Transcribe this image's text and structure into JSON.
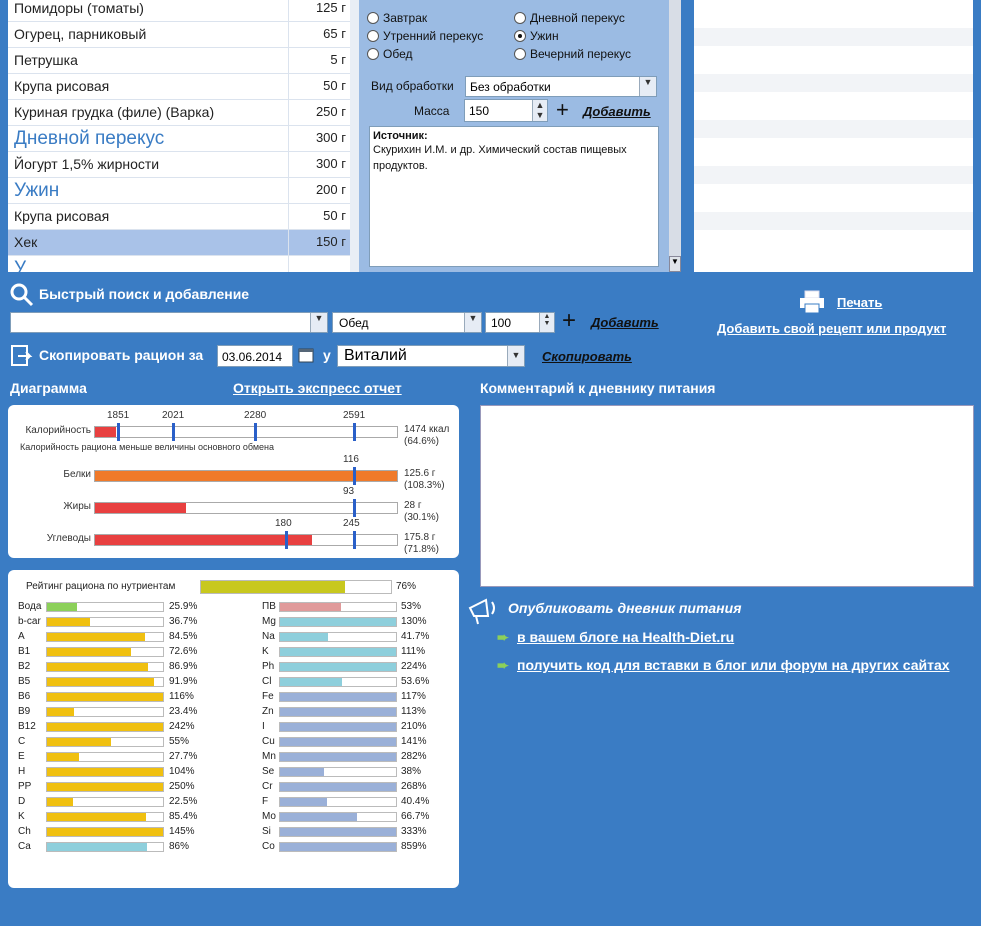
{
  "food_list": [
    {
      "name": "Помидоры (томаты)",
      "weight": "125 г",
      "type": "item"
    },
    {
      "name": "Огурец, парниковый",
      "weight": "65 г",
      "type": "item"
    },
    {
      "name": "Петрушка",
      "weight": "5 г",
      "type": "item"
    },
    {
      "name": "Крупа рисовая",
      "weight": "50 г",
      "type": "item"
    },
    {
      "name": "Куриная грудка (филе) (Варка)",
      "weight": "250 г",
      "type": "item"
    },
    {
      "name": "Дневной перекус",
      "weight": "300 г",
      "type": "header"
    },
    {
      "name": "Йогурт 1,5% жирности",
      "weight": "300 г",
      "type": "item"
    },
    {
      "name": "Ужин",
      "weight": "200 г",
      "type": "header"
    },
    {
      "name": "Крупа рисовая",
      "weight": "50 г",
      "type": "item"
    },
    {
      "name": "Хек",
      "weight": "150 г",
      "type": "selected"
    },
    {
      "name": "У",
      "weight": "",
      "type": "header"
    }
  ],
  "meal_options": {
    "breakfast": "Завтрак",
    "day_snack": "Дневной перекус",
    "morning_snack": "Утренний перекус",
    "dinner": "Ужин",
    "lunch": "Обед",
    "evening_snack": "Вечерний перекус",
    "selected": "Ужин"
  },
  "processing": {
    "label": "Вид обработки",
    "value": "Без обработки"
  },
  "mass": {
    "label": "Масса",
    "value": "150"
  },
  "add_label": "Добавить",
  "source": {
    "title": "Источник:",
    "text": "Скурихин И.М. и др. Химический состав пищевых продуктов."
  },
  "quick_search": {
    "title": "Быстрый поиск и добавление",
    "meal": "Обед",
    "amount": "100",
    "add": "Добавить",
    "input_value": ""
  },
  "print_label": "Печать",
  "add_recipe": "Добавить свой рецепт или продукт",
  "copy": {
    "title": "Скопировать рацион за",
    "date": "03.06.2014",
    "for": "у",
    "person": "Виталий",
    "action": "Скопировать"
  },
  "diagram": {
    "title": "Диаграмма",
    "express": "Открыть экспресс отчет"
  },
  "comment_title": "Комментарий к дневнику питания",
  "publish": {
    "title": "Опубликовать дневник питания",
    "link1": "в вашем блоге на Health-Diet.ru",
    "link2": "получить код для вставки в блог или форум на других сайтах"
  },
  "calories": {
    "label": "Калорийность",
    "value_text": "1474 ккал",
    "pct_text": "(64.6%)",
    "note": "Калорийность рациона меньше величины основного обмена",
    "markers": [
      "1851",
      "2021",
      "2280",
      "2591"
    ],
    "fill_fraction": 0.07
  },
  "macros": [
    {
      "label": "Белки",
      "marker": "116",
      "value_text": "125.6 г",
      "pct_text": "(108.3%)",
      "fill_fraction": 1.08,
      "color": "#f07a2a"
    },
    {
      "label": "Жиры",
      "marker": "93",
      "value_text": "28 г",
      "pct_text": "(30.1%)",
      "fill_fraction": 0.3,
      "color": "#e84040"
    },
    {
      "label": "Углеводы",
      "markers": [
        "180",
        "245"
      ],
      "value_text": "175.8 г",
      "pct_text": "(71.8%)",
      "fill_fraction": 0.72,
      "color": "#e84040"
    }
  ],
  "rating": {
    "label": "Рейтинг рациона по нутриентам",
    "pct": "76%",
    "fraction": 0.76,
    "color": "#c8c81e"
  },
  "nutrients_left": [
    {
      "n": "Вода",
      "p": "25.9%",
      "f": 0.259,
      "c": "#8cd05a"
    },
    {
      "n": "b-car",
      "p": "36.7%",
      "f": 0.367,
      "c": "#f0c010"
    },
    {
      "n": "A",
      "p": "84.5%",
      "f": 0.845,
      "c": "#f0c010"
    },
    {
      "n": "B1",
      "p": "72.6%",
      "f": 0.726,
      "c": "#f0c010"
    },
    {
      "n": "B2",
      "p": "86.9%",
      "f": 0.869,
      "c": "#f0c010"
    },
    {
      "n": "B5",
      "p": "91.9%",
      "f": 0.919,
      "c": "#f0c010"
    },
    {
      "n": "B6",
      "p": "116%",
      "f": 1.0,
      "c": "#f0c010"
    },
    {
      "n": "B9",
      "p": "23.4%",
      "f": 0.234,
      "c": "#f0c010"
    },
    {
      "n": "B12",
      "p": "242%",
      "f": 1.0,
      "c": "#f0c010"
    },
    {
      "n": "C",
      "p": "55%",
      "f": 0.55,
      "c": "#f0c010"
    },
    {
      "n": "E",
      "p": "27.7%",
      "f": 0.277,
      "c": "#f0c010"
    },
    {
      "n": "H",
      "p": "104%",
      "f": 1.0,
      "c": "#f0c010"
    },
    {
      "n": "PP",
      "p": "250%",
      "f": 1.0,
      "c": "#f0c010"
    },
    {
      "n": "D",
      "p": "22.5%",
      "f": 0.225,
      "c": "#f0c010"
    },
    {
      "n": "K",
      "p": "85.4%",
      "f": 0.854,
      "c": "#f0c010"
    },
    {
      "n": "Ch",
      "p": "145%",
      "f": 1.0,
      "c": "#f0c010"
    },
    {
      "n": "Ca",
      "p": "86%",
      "f": 0.86,
      "c": "#8ecfdc"
    }
  ],
  "nutrients_right": [
    {
      "n": "ПВ",
      "p": "53%",
      "f": 0.53,
      "c": "#e09a9a"
    },
    {
      "n": "Mg",
      "p": "130%",
      "f": 1.0,
      "c": "#8ecfdc"
    },
    {
      "n": "Na",
      "p": "41.7%",
      "f": 0.417,
      "c": "#8ecfdc"
    },
    {
      "n": "K",
      "p": "111%",
      "f": 1.0,
      "c": "#8ecfdc"
    },
    {
      "n": "Ph",
      "p": "224%",
      "f": 1.0,
      "c": "#8ecfdc"
    },
    {
      "n": "Cl",
      "p": "53.6%",
      "f": 0.536,
      "c": "#8ecfdc"
    },
    {
      "n": "Fe",
      "p": "117%",
      "f": 1.0,
      "c": "#9ab0d8"
    },
    {
      "n": "Zn",
      "p": "113%",
      "f": 1.0,
      "c": "#9ab0d8"
    },
    {
      "n": "I",
      "p": "210%",
      "f": 1.0,
      "c": "#9ab0d8"
    },
    {
      "n": "Cu",
      "p": "141%",
      "f": 1.0,
      "c": "#9ab0d8"
    },
    {
      "n": "Mn",
      "p": "282%",
      "f": 1.0,
      "c": "#9ab0d8"
    },
    {
      "n": "Se",
      "p": "38%",
      "f": 0.38,
      "c": "#9ab0d8"
    },
    {
      "n": "Cr",
      "p": "268%",
      "f": 1.0,
      "c": "#9ab0d8"
    },
    {
      "n": "F",
      "p": "40.4%",
      "f": 0.404,
      "c": "#9ab0d8"
    },
    {
      "n": "Mo",
      "p": "66.7%",
      "f": 0.667,
      "c": "#9ab0d8"
    },
    {
      "n": "Si",
      "p": "333%",
      "f": 1.0,
      "c": "#9ab0d8"
    },
    {
      "n": "Co",
      "p": "859%",
      "f": 1.0,
      "c": "#9ab0d8"
    }
  ]
}
